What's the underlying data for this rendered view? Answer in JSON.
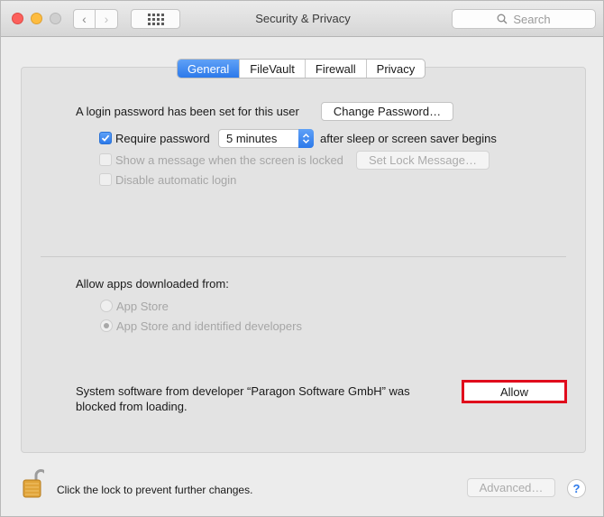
{
  "window": {
    "title": "Security & Privacy",
    "nav_back_glyph": "‹",
    "nav_forward_glyph": "›"
  },
  "search": {
    "placeholder": "Search",
    "icon": "search-icon"
  },
  "tabs": [
    {
      "label": "General",
      "active": true
    },
    {
      "label": "FileVault",
      "active": false
    },
    {
      "label": "Firewall",
      "active": false
    },
    {
      "label": "Privacy",
      "active": false
    }
  ],
  "general": {
    "login_password_text": "A login password has been set for this user",
    "change_password_button": "Change Password…",
    "require_password": {
      "label": "Require password",
      "checked": true,
      "selected_interval": "5 minutes",
      "suffix": "after sleep or screen saver begins"
    },
    "show_message": {
      "label": "Show a message when the screen is locked",
      "checked": false,
      "enabled": false,
      "button": "Set Lock Message…"
    },
    "disable_auto_login": {
      "label": "Disable automatic login",
      "checked": false,
      "enabled": false
    }
  },
  "allow_apps": {
    "heading": "Allow apps downloaded from:",
    "options": [
      {
        "label": "App Store",
        "selected": false
      },
      {
        "label": "App Store and identified developers",
        "selected": true
      }
    ]
  },
  "blocked": {
    "line1": "System software from developer “Paragon Software GmbH” was",
    "line2": "blocked from loading.",
    "allow_button": "Allow",
    "highlight_color": "#e00b1c"
  },
  "footer": {
    "lock_text": "Click the lock to prevent further changes.",
    "advanced_button": "Advanced…",
    "help_glyph": "?"
  },
  "colors": {
    "accent": "#2c79ea",
    "window_bg": "#ececec",
    "panel_bg": "#e3e3e3"
  }
}
